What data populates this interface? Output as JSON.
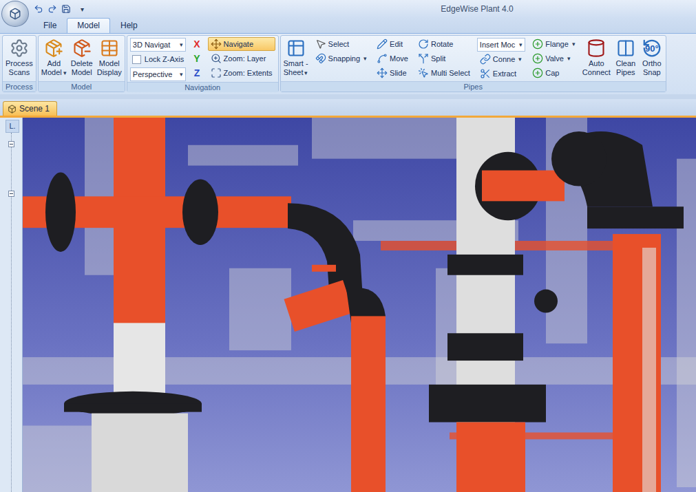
{
  "window": {
    "title": "EdgeWise Plant 4.0"
  },
  "quick_access": {
    "menu_arrow": "▾"
  },
  "menu_tabs": [
    {
      "label": "File",
      "selected": false
    },
    {
      "label": "Model",
      "selected": true
    },
    {
      "label": "Help",
      "selected": false
    }
  ],
  "ribbon": {
    "groups": [
      {
        "label": "Process",
        "columns": [
          {
            "kind": "large",
            "lines": [
              "Process",
              "Scans"
            ]
          }
        ]
      },
      {
        "label": "Model",
        "columns": [
          {
            "kind": "large",
            "lines": [
              "Add",
              "Model"
            ],
            "arrow": "▾"
          },
          {
            "kind": "large",
            "lines": [
              "Delete",
              "Model"
            ]
          },
          {
            "kind": "large",
            "lines": [
              "Model",
              "Display"
            ]
          }
        ]
      },
      {
        "label": "Navigation",
        "columns": [
          {
            "kind": "stack",
            "items": [
              {
                "kind": "dropdown",
                "label": "3D Navigat",
                "arrow": "▾"
              },
              {
                "kind": "checkbox",
                "label": "Lock Z-Axis",
                "checked": false
              },
              {
                "kind": "dropdown",
                "label": "Perspective",
                "arrow": "▾"
              }
            ]
          },
          {
            "kind": "stack",
            "items": [
              {
                "kind": "axis",
                "label": "X",
                "color": "#e02b2b"
              },
              {
                "kind": "axis",
                "label": "Y",
                "color": "#2aa62a"
              },
              {
                "kind": "axis",
                "label": "Z",
                "color": "#2b4fc9"
              }
            ]
          },
          {
            "kind": "stack",
            "items": [
              {
                "kind": "button",
                "label": "Navigate",
                "selected": true
              },
              {
                "kind": "button",
                "label": "Zoom: Layer",
                "selected": false
              },
              {
                "kind": "button",
                "label": "Zoom: Extents",
                "selected": false
              }
            ]
          }
        ]
      },
      {
        "label": "Pipes",
        "columns": [
          {
            "kind": "large",
            "lines": [
              "Smart -",
              "Sheet"
            ],
            "arrow": "▾"
          },
          {
            "kind": "stack",
            "items": [
              {
                "kind": "button",
                "label": "Select",
                "selected": false
              },
              {
                "kind": "button",
                "label": "Snapping",
                "arrow": "▾",
                "selected": false
              }
            ]
          },
          {
            "kind": "stack",
            "items": [
              {
                "kind": "button",
                "label": "Edit",
                "selected": false
              },
              {
                "kind": "button",
                "label": "Move",
                "selected": false
              },
              {
                "kind": "button",
                "label": "Slide",
                "selected": false
              }
            ]
          },
          {
            "kind": "stack",
            "items": [
              {
                "kind": "button",
                "label": "Rotate",
                "selected": false
              },
              {
                "kind": "button",
                "label": "Split",
                "selected": false
              },
              {
                "kind": "button",
                "label": "Multi Select",
                "selected": false
              }
            ]
          },
          {
            "kind": "stack",
            "items": [
              {
                "kind": "dropdown",
                "label": "Insert Moc",
                "arrow": "▾"
              },
              {
                "kind": "button",
                "label": "Conne",
                "arrow": "▾",
                "selected": false
              },
              {
                "kind": "button",
                "label": "Extract",
                "selected": false
              }
            ]
          },
          {
            "kind": "stack",
            "items": [
              {
                "kind": "button",
                "label": "Flange",
                "arrow": "▾",
                "selected": false
              },
              {
                "kind": "button",
                "label": "Valve",
                "arrow": "▾",
                "selected": false
              },
              {
                "kind": "button",
                "label": "Cap",
                "selected": false
              }
            ]
          },
          {
            "kind": "large",
            "lines": [
              "Auto",
              "Connect"
            ]
          },
          {
            "kind": "large",
            "lines": [
              "Clean",
              "Pipes"
            ]
          },
          {
            "kind": "large",
            "lines": [
              "Ortho",
              "Snap"
            ],
            "icon_text": "90°"
          }
        ]
      }
    ]
  },
  "document_tabs": [
    {
      "label": "Scene 1",
      "selected": true
    }
  ],
  "side_panel": {
    "header": "L.",
    "nodes": [
      {
        "expanded": true
      },
      {
        "expanded": true
      }
    ]
  }
}
